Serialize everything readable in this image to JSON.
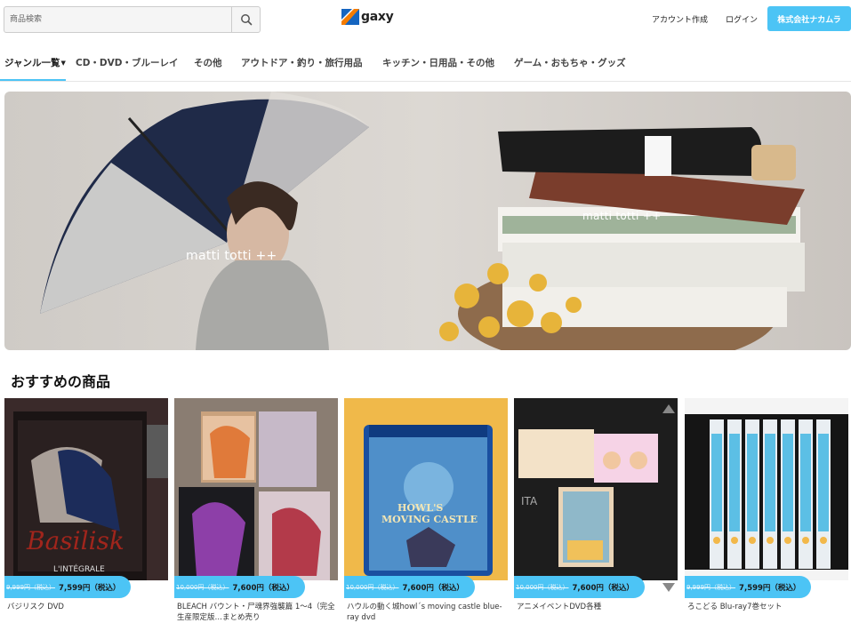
{
  "header": {
    "search_placeholder": "商品検索",
    "logo_text": "gaxy",
    "account_create": "アカウント作成",
    "login": "ログイン",
    "company_button": "株式会社ナカムラ"
  },
  "nav": {
    "items": [
      {
        "label": "ジャンル一覧"
      },
      {
        "label": "CD・DVD・ブルーレイ"
      },
      {
        "label": "その他"
      },
      {
        "label": "アウトドア・釣り・旅行用品"
      },
      {
        "label": "キッチン・日用品・その他"
      },
      {
        "label": "ゲーム・おもちゃ・グッズ"
      }
    ]
  },
  "banner": {
    "brand_left": "matti totti ++",
    "brand_right": "matti totti ++"
  },
  "section": {
    "title": "おすすめの商品"
  },
  "products": [
    {
      "old_price": "9,999円（税込）",
      "price": "7,599円（税込）",
      "title": "バジリスク DVD"
    },
    {
      "old_price": "10,000円（税込）",
      "price": "7,600円（税込）",
      "title": "BLEACH バウント・尸魂界強襲篇 1〜4（完全生産限定版…まとめ売り"
    },
    {
      "old_price": "10,000円（税込）",
      "price": "7,600円（税込）",
      "title": "ハウルの動く城howl´s moving castle blue-ray dvd"
    },
    {
      "old_price": "10,000円（税込）",
      "price": "7,600円（税込）",
      "title": "アニメイベントDVD各種"
    },
    {
      "old_price": "9,999円（税込）",
      "price": "7,599円（税込）",
      "title": "ろこどる Blu-ray7巻セット"
    }
  ],
  "colors": {
    "accent": "#4cc4f5",
    "logo_blue": "#1565c0",
    "logo_orange": "#f57c00"
  }
}
